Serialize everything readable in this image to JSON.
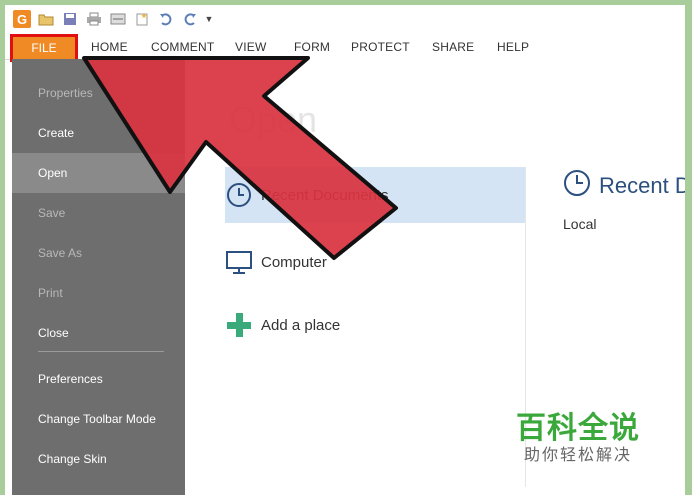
{
  "quick_access": {
    "app_logo": "G",
    "icons": [
      "open-folder-icon",
      "save-icon",
      "print-icon",
      "scan-icon",
      "new-icon",
      "undo-icon",
      "redo-icon",
      "customize-dropdown-icon"
    ]
  },
  "ribbon": {
    "file": "FILE",
    "tabs": [
      "HOME",
      "COMMENT",
      "VIEW",
      "FORM",
      "PROTECT",
      "SHARE",
      "HELP"
    ]
  },
  "sidebar": {
    "items": [
      {
        "label": "Properties",
        "enabled": false
      },
      {
        "label": "Create",
        "enabled": true
      },
      {
        "label": "Open",
        "enabled": true,
        "selected": true
      },
      {
        "label": "Save",
        "enabled": false
      },
      {
        "label": "Save As",
        "enabled": false
      },
      {
        "label": "Print",
        "enabled": false
      },
      {
        "label": "Close",
        "enabled": true
      },
      {
        "label": "Preferences",
        "enabled": true
      },
      {
        "label": "Change Toolbar Mode",
        "enabled": true
      },
      {
        "label": "Change Skin",
        "enabled": true
      }
    ]
  },
  "main": {
    "heading": "Open",
    "locations": [
      {
        "label": "Recent Documents",
        "icon": "clock-icon"
      },
      {
        "label": "Computer",
        "icon": "computer-icon"
      },
      {
        "label": "Add a place",
        "icon": "plus-icon"
      }
    ],
    "recent_title": "Recent D",
    "recent_sub": "Local"
  },
  "watermark": {
    "line1": "百科全说",
    "line2": "助你轻松解决"
  },
  "colors": {
    "accent_orange": "#f08a24",
    "highlight_red": "#e01010",
    "arrow_red": "#d9343f",
    "sidebar_bg": "#6e6e6e",
    "selected_location": "#d5e4f5",
    "outer_border": "#a8cc9a"
  }
}
